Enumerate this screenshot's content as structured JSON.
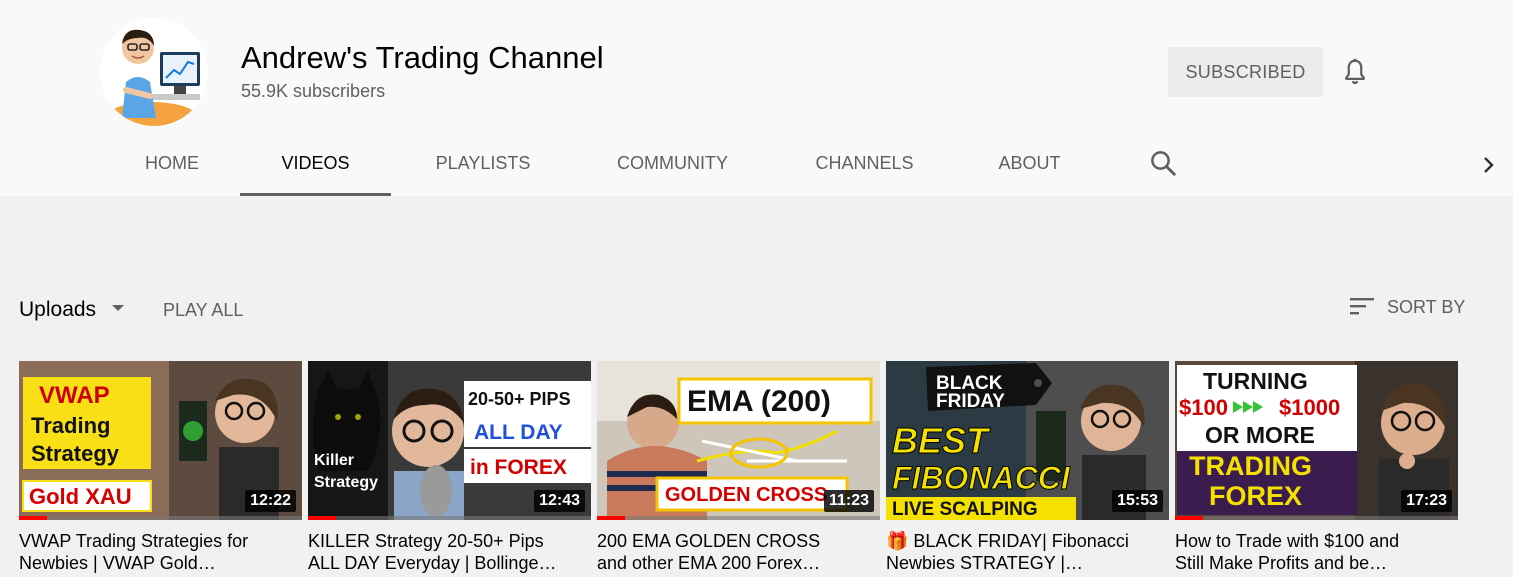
{
  "channel": {
    "name": "Andrew's Trading Channel",
    "subscribers": "55.9K subscribers",
    "subscribe_label": "SUBSCRIBED"
  },
  "tabs": [
    {
      "label": "HOME",
      "active": false
    },
    {
      "label": "VIDEOS",
      "active": true
    },
    {
      "label": "PLAYLISTS",
      "active": false
    },
    {
      "label": "COMMUNITY",
      "active": false
    },
    {
      "label": "CHANNELS",
      "active": false
    },
    {
      "label": "ABOUT",
      "active": false
    }
  ],
  "toolbar": {
    "uploads_label": "Uploads",
    "play_all_label": "PLAY ALL",
    "sort_label": "SORT BY"
  },
  "icons": {
    "bell": "bell-icon",
    "search": "search-icon",
    "next": "chevron-right-icon",
    "sort": "sort-icon",
    "caret": "caret-down-icon"
  },
  "colors": {
    "progress": "#ff0000",
    "header_bg": "#f9f9f9",
    "page_bg": "#f1f1f1"
  },
  "videos": [
    {
      "duration": "12:22",
      "progress_pct": 10,
      "title_line1": "VWAP Trading Strategies for",
      "title_line2": "Newbies | VWAP Gold…",
      "thumb": {
        "t1": "VWAP",
        "t2": "Trading",
        "t3": "Strategy",
        "t4": "Gold XAU"
      }
    },
    {
      "duration": "12:43",
      "progress_pct": 10,
      "title_line1": "KILLER Strategy 20-50+ Pips",
      "title_line2": "ALL DAY Everyday | Bollinge…",
      "thumb": {
        "t1": "20-50+ PIPS",
        "t2": "ALL DAY",
        "t3": "in FOREX",
        "t4": "Killer",
        "t5": "Strategy"
      }
    },
    {
      "duration": "11:23",
      "progress_pct": 10,
      "title_line1": "200 EMA GOLDEN CROSS",
      "title_line2": "and other EMA 200 Forex…",
      "thumb": {
        "t1": "EMA (200)",
        "t2": "GOLDEN CROSS"
      }
    },
    {
      "duration": "15:53",
      "progress_pct": 0,
      "title_line1": "🎁 BLACK FRIDAY| Fibonacci",
      "title_line2": "Newbies STRATEGY |…",
      "thumb": {
        "t1": "BLACK",
        "t2": "FRIDAY",
        "t3": "BEST",
        "t4": "FIBONACCI",
        "t5": "LIVE SCALPING"
      }
    },
    {
      "duration": "17:23",
      "progress_pct": 10,
      "title_line1": "How to Trade with $100 and",
      "title_line2": "Still Make Profits and be…",
      "thumb": {
        "t1": "TURNING",
        "t2": "$100",
        "t3": "$1000",
        "t4": "OR MORE",
        "t5": "TRADING",
        "t6": "FOREX"
      }
    }
  ]
}
